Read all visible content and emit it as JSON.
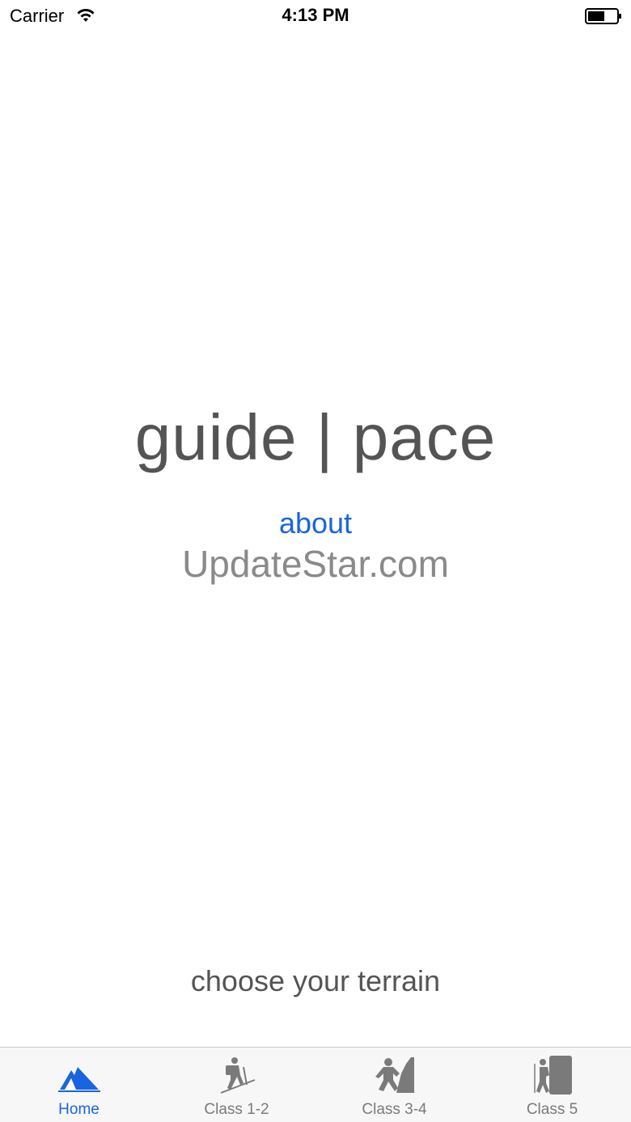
{
  "status_bar": {
    "carrier": "Carrier",
    "time": "4:13 PM",
    "wifi_icon": "wifi-icon",
    "battery_icon": "battery-icon"
  },
  "main": {
    "title": "guide | pace",
    "about_link": "about",
    "watermark": "UpdateStar.com",
    "prompt": "choose your terrain"
  },
  "tab_bar": {
    "active_color": "#1a64e0",
    "inactive_color": "#7a7a7a",
    "tabs": [
      {
        "label": "Home",
        "icon": "tent-icon",
        "active": true
      },
      {
        "label": "Class 1-2",
        "icon": "hiker-icon",
        "active": false
      },
      {
        "label": "Class 3-4",
        "icon": "scrambler-icon",
        "active": false
      },
      {
        "label": "Class 5",
        "icon": "climber-icon",
        "active": false
      }
    ]
  }
}
